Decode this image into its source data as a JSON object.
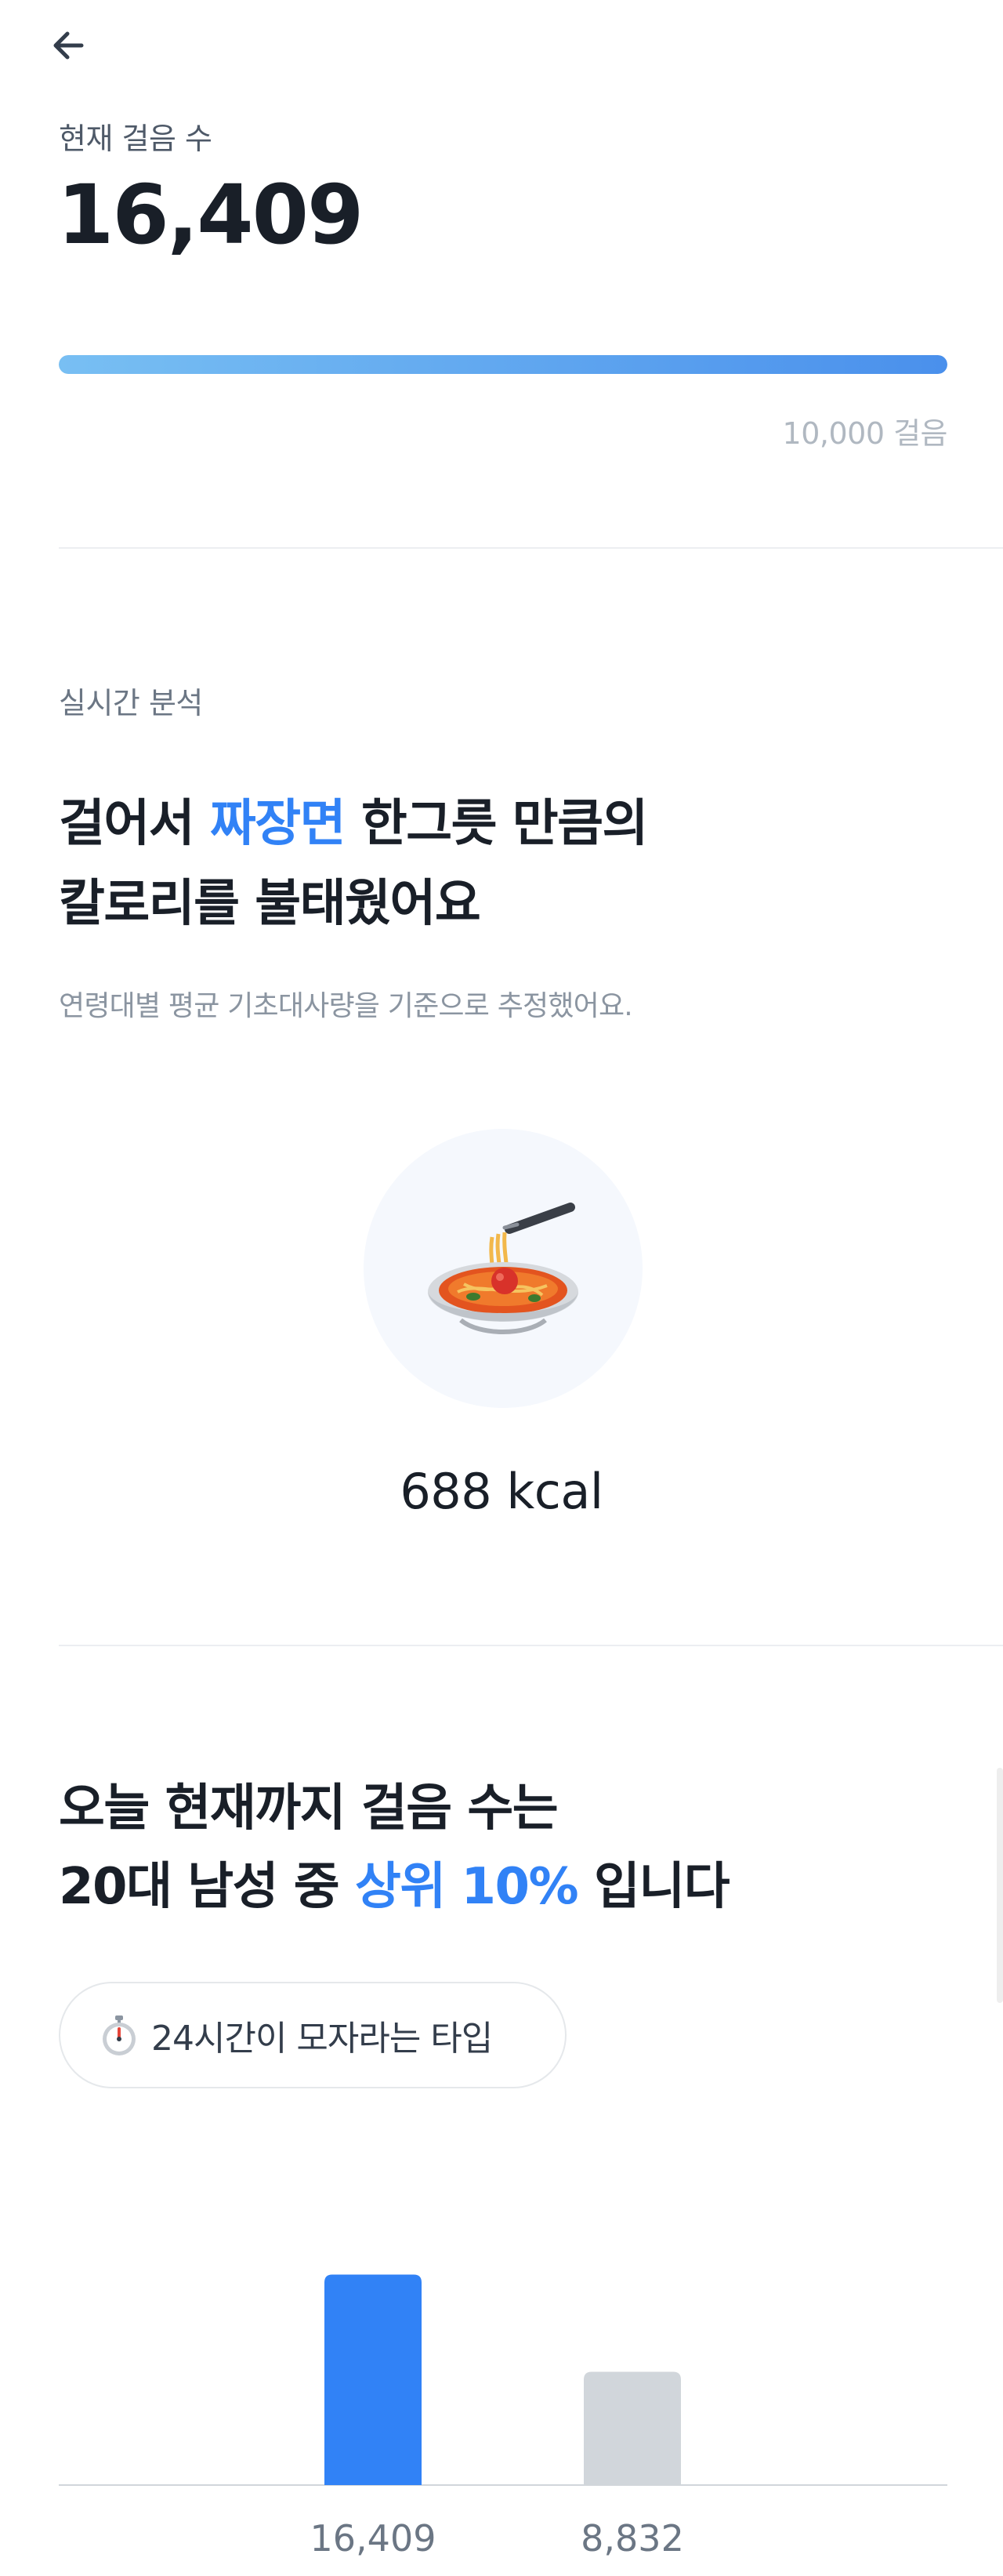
{
  "header": {
    "back_icon": "arrow-left-icon",
    "steps_label": "현재 걸음 수",
    "steps_value": "16,409",
    "goal_label": "10,000 걸음",
    "progress": 1.0,
    "progress_colors": [
      "#78bff3",
      "#4a90ec"
    ]
  },
  "analysis": {
    "section_label": "실시간 분석",
    "headline_prefix": "걸어서 ",
    "food_name": "짜장면",
    "headline_suffix": " 한그릇 만큼의",
    "headline_line2": "칼로리를 불태웠어요",
    "note": "연령대별 평균 기초대사량을 기준으로 추정했어요.",
    "food_icon": "noodle-bowl-icon",
    "kcal": "688 kcal"
  },
  "ranking": {
    "line1": "오늘 현재까지 걸음 수는",
    "line2_prefix": "20대 남성 중 ",
    "rank": "상위 10%",
    "line2_suffix": " 입니다",
    "tag_icon": "stopwatch-icon",
    "tag_label": "24시간이 모자라는 타입"
  },
  "chart_data": {
    "type": "bar",
    "categories": [
      "16,409",
      "8,832"
    ],
    "values": [
      16409,
      8832
    ],
    "colors": [
      "#3182f6",
      "#d1d6db"
    ],
    "ylim": [
      0,
      22000
    ],
    "grid": false
  },
  "colors": {
    "accent": "#3182f6",
    "text": "#191f28",
    "muted": "#8b95a1"
  }
}
